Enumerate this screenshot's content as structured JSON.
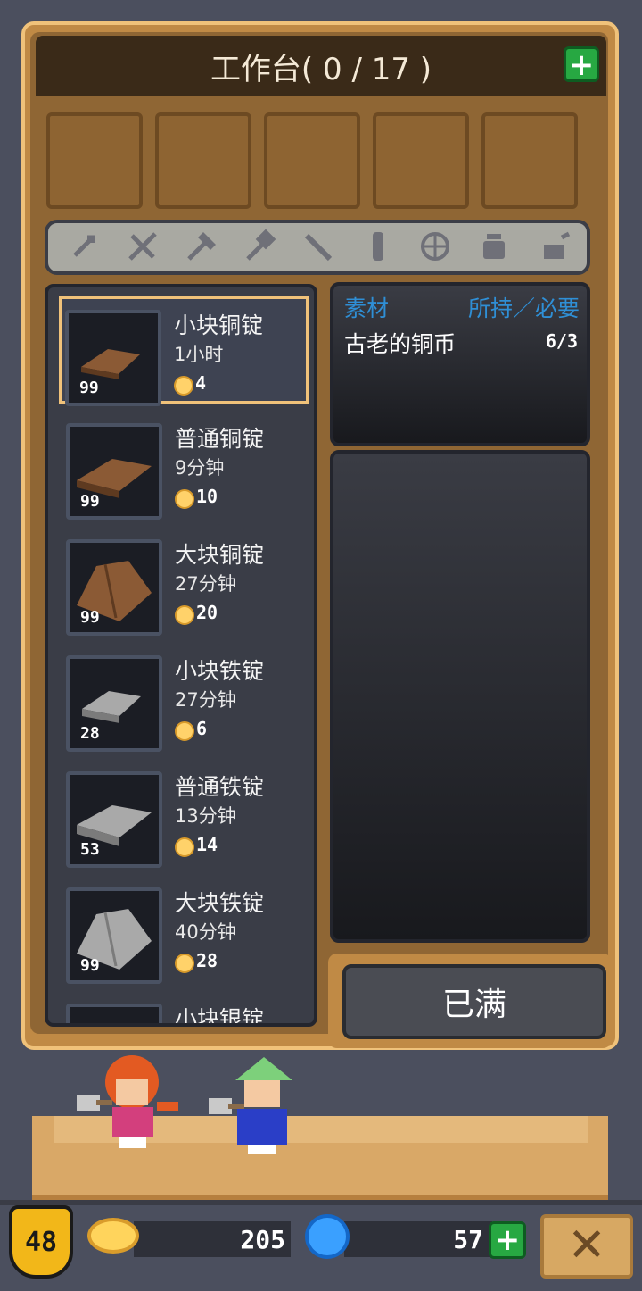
{
  "workbench": {
    "title": "工作台( 0 / 17 )",
    "add_icon": "plus-icon"
  },
  "slots": [
    {},
    {},
    {},
    {},
    {}
  ],
  "filters": [
    "dagger-icon",
    "sword-icon",
    "axe-icon",
    "hammer-icon",
    "staff-icon",
    "gun-icon",
    "bow-icon",
    "pot-icon",
    "misc-icon"
  ],
  "items": [
    {
      "name": "小块铜锭",
      "time": "1小时",
      "price": "4",
      "count": "99",
      "color": "#8b5a35"
    },
    {
      "name": "普通铜锭",
      "time": "9分钟",
      "price": "10",
      "count": "99",
      "color": "#8b5a35"
    },
    {
      "name": "大块铜锭",
      "time": "27分钟",
      "price": "20",
      "count": "99",
      "color": "#8b5a35"
    },
    {
      "name": "小块铁锭",
      "time": "27分钟",
      "price": "6",
      "count": "28",
      "color": "#a9a9a9"
    },
    {
      "name": "普通铁锭",
      "time": "13分钟",
      "price": "14",
      "count": "53",
      "color": "#a9a9a9"
    },
    {
      "name": "大块铁锭",
      "time": "40分钟",
      "price": "28",
      "count": "99",
      "color": "#a9a9a9"
    },
    {
      "name": "小块银锭"
    }
  ],
  "materials": {
    "header_left": "素材",
    "header_right": "所持／必要",
    "rows": [
      {
        "name": "古老的铜币",
        "qty": "6/3"
      }
    ]
  },
  "action_button": {
    "label": "已满"
  },
  "status": {
    "level": "48",
    "gold": "205",
    "gems": "57"
  },
  "colors": {
    "accent_green": "#27a842",
    "panel": "#c08a45",
    "material_header": "#2f8fd6"
  }
}
